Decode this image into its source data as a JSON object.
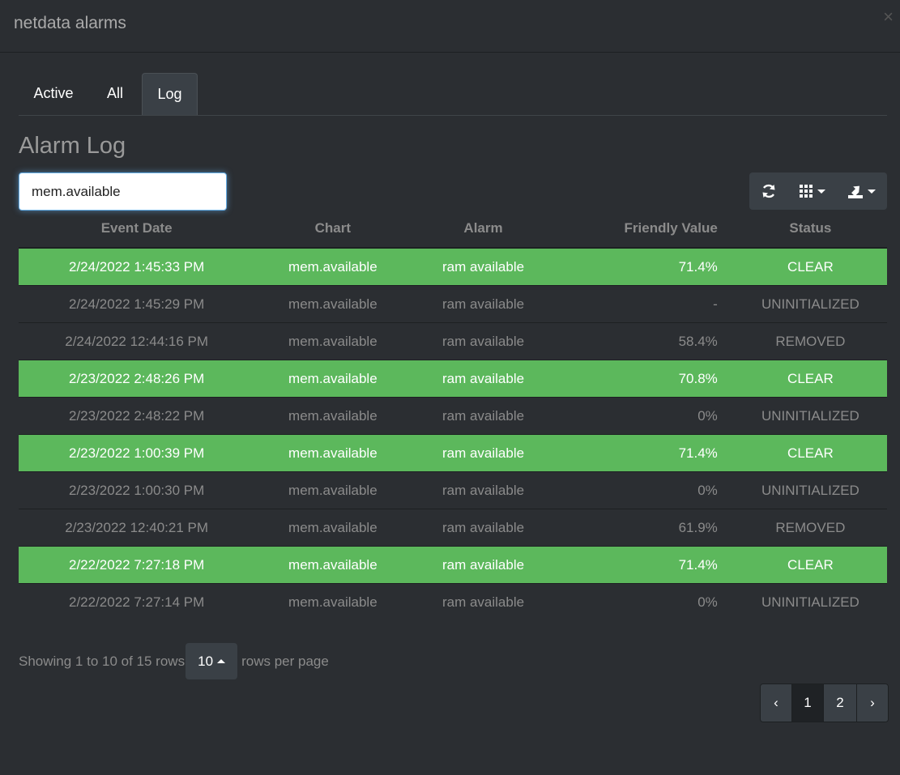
{
  "window": {
    "title": "netdata alarms",
    "close": "×"
  },
  "tabs": [
    {
      "label": "Active",
      "active": false
    },
    {
      "label": "All",
      "active": false
    },
    {
      "label": "Log",
      "active": true
    }
  ],
  "section_title": "Alarm Log",
  "search": {
    "value": "mem.available"
  },
  "toolbar": {
    "buttons": [
      "refresh-icon",
      "columns-icon",
      "export-icon"
    ]
  },
  "table": {
    "headers": [
      "Event Date",
      "Chart",
      "Alarm",
      "Friendly Value",
      "Status"
    ],
    "rows": [
      {
        "date": "2/24/2022 1:45:33 PM",
        "chart": "mem.available",
        "alarm": "ram available",
        "value": "71.4%",
        "status": "CLEAR",
        "highlight": true
      },
      {
        "date": "2/24/2022 1:45:29 PM",
        "chart": "mem.available",
        "alarm": "ram available",
        "value": "-",
        "status": "UNINITIALIZED",
        "highlight": false
      },
      {
        "date": "2/24/2022 12:44:16 PM",
        "chart": "mem.available",
        "alarm": "ram available",
        "value": "58.4%",
        "status": "REMOVED",
        "highlight": false
      },
      {
        "date": "2/23/2022 2:48:26 PM",
        "chart": "mem.available",
        "alarm": "ram available",
        "value": "70.8%",
        "status": "CLEAR",
        "highlight": true
      },
      {
        "date": "2/23/2022 2:48:22 PM",
        "chart": "mem.available",
        "alarm": "ram available",
        "value": "0%",
        "status": "UNINITIALIZED",
        "highlight": false
      },
      {
        "date": "2/23/2022 1:00:39 PM",
        "chart": "mem.available",
        "alarm": "ram available",
        "value": "71.4%",
        "status": "CLEAR",
        "highlight": true
      },
      {
        "date": "2/23/2022 1:00:30 PM",
        "chart": "mem.available",
        "alarm": "ram available",
        "value": "0%",
        "status": "UNINITIALIZED",
        "highlight": false
      },
      {
        "date": "2/23/2022 12:40:21 PM",
        "chart": "mem.available",
        "alarm": "ram available",
        "value": "61.9%",
        "status": "REMOVED",
        "highlight": false
      },
      {
        "date": "2/22/2022 7:27:18 PM",
        "chart": "mem.available",
        "alarm": "ram available",
        "value": "71.4%",
        "status": "CLEAR",
        "highlight": true
      },
      {
        "date": "2/22/2022 7:27:14 PM",
        "chart": "mem.available",
        "alarm": "ram available",
        "value": "0%",
        "status": "UNINITIALIZED",
        "highlight": false
      }
    ]
  },
  "footer": {
    "showing": "Showing 1 to 10 of 15 rows",
    "page_size": "10",
    "per_page": "rows per page"
  },
  "pagination": {
    "prev": "‹",
    "pages": [
      "1",
      "2"
    ],
    "active": "1",
    "next": "›"
  },
  "colors": {
    "background": "#2b2e32",
    "success_row": "#5cb85c",
    "muted_text": "#8b8b8b"
  }
}
